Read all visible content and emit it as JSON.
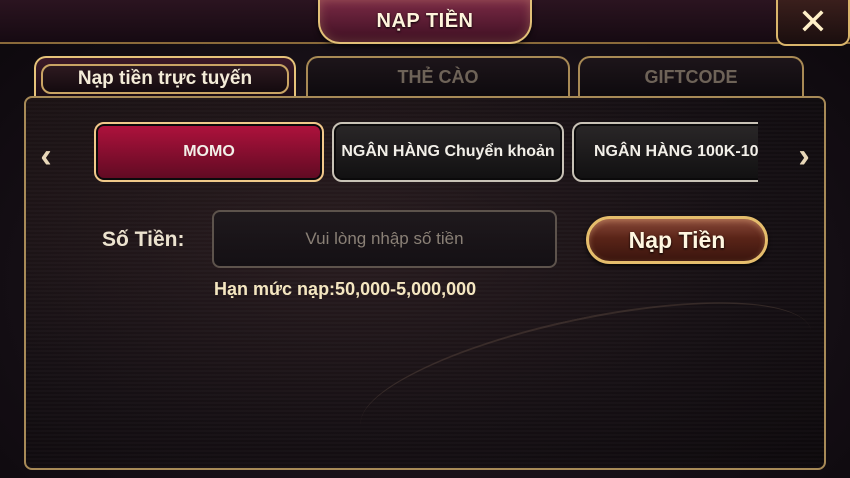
{
  "header": {
    "title": "NẠP TIỀN",
    "close_icon": "close-icon"
  },
  "tabs": [
    {
      "label": "Nạp tiền trực tuyến",
      "active": true
    },
    {
      "label": "THẺ CÀO",
      "active": false
    },
    {
      "label": "GIFTCODE",
      "active": false
    }
  ],
  "methods": [
    {
      "label": "MOMO",
      "active": true
    },
    {
      "label": "NGÂN HÀNG Chuyển khoản",
      "active": false
    },
    {
      "label": "NGÂN HÀNG 100K-10",
      "active": false
    }
  ],
  "nav": {
    "prev_icon": "chevron-left-icon",
    "next_icon": "chevron-right-icon"
  },
  "form": {
    "amount_label": "Số Tiền:",
    "amount_value": "",
    "amount_placeholder": "Vui lòng nhập số tiền",
    "submit_label": "Nạp Tiền",
    "limit_text": "Hạn mức nạp:50,000-5,000,000"
  },
  "colors": {
    "accent_gold": "#e5bd6c",
    "active_crimson": "#b0123d"
  }
}
